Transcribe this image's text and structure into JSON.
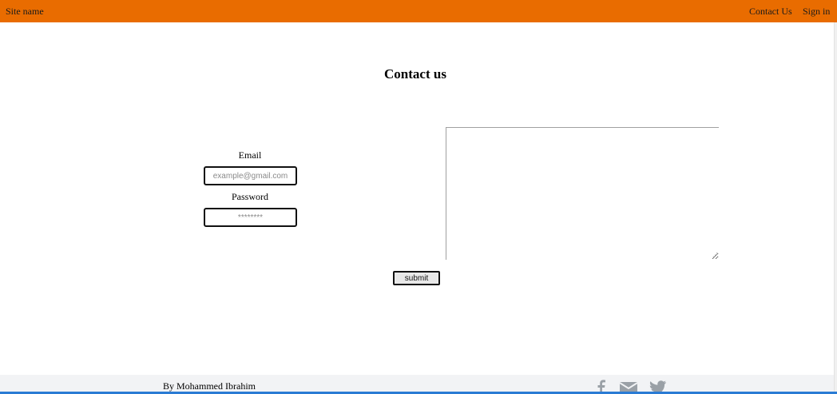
{
  "navbar": {
    "brand": "Site name",
    "links": [
      "Contact Us",
      "Sign in"
    ],
    "background": "#e96c00"
  },
  "page": {
    "title": "Contact us"
  },
  "form": {
    "email_label": "Email",
    "email_placeholder": "example@gmail.com",
    "email_value": "",
    "password_label": "Password",
    "password_placeholder": "********",
    "password_value": "",
    "message_value": "",
    "submit_label": "submit"
  },
  "footer": {
    "author": "By Mohammed Ibrahim",
    "icons": [
      "facebook-icon",
      "mail-icon",
      "twitter-icon"
    ],
    "icon_color": "#9aa0a6"
  }
}
